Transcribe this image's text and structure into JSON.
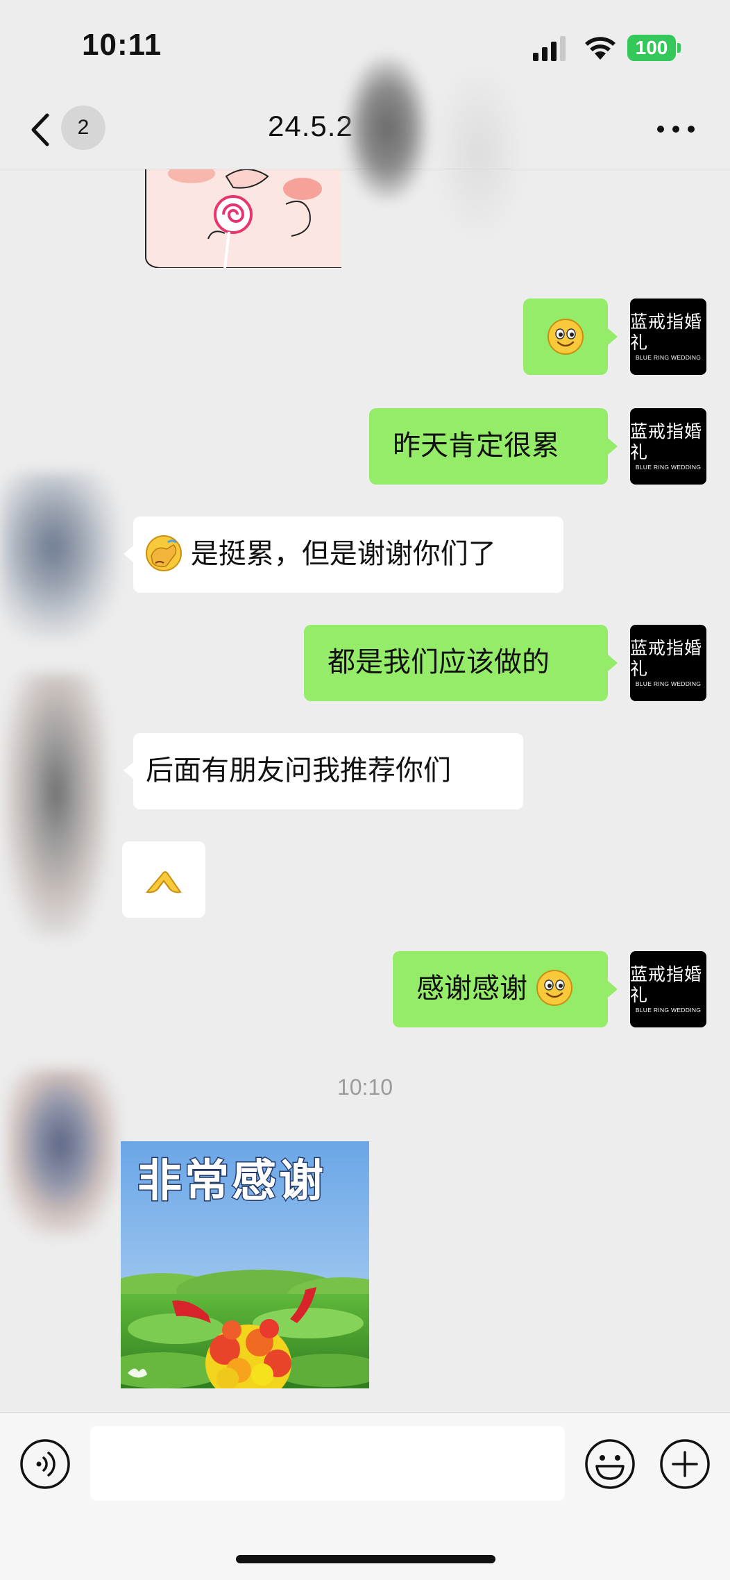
{
  "status_bar": {
    "time": "10:11",
    "battery": "100"
  },
  "nav": {
    "back_badge": "2",
    "title": "24.5.2"
  },
  "brand_avatar": {
    "cn": "蓝戒指婚礼",
    "en": "BLUE RING WEDDING"
  },
  "messages": [
    {
      "from": "me",
      "text": "",
      "emoji": "smile"
    },
    {
      "from": "me",
      "text": "昨天肯定很累"
    },
    {
      "from": "other",
      "text": "是挺累，但是谢谢你们了",
      "emoji_before": "facepalm"
    },
    {
      "from": "me",
      "text": "都是我们应该做的"
    },
    {
      "from": "other",
      "text": "后面有朋友问我推荐你们"
    },
    {
      "from": "other",
      "text": "",
      "emoji": "thanks-hands"
    },
    {
      "from": "me",
      "text": "感谢感谢",
      "emoji_after": "smile"
    }
  ],
  "timestamp": "10:10",
  "sticker": {
    "text": "非常感谢"
  },
  "colors": {
    "me_bubble": "#95ec69",
    "other_bubble": "#ffffff",
    "background": "#ededed",
    "battery": "#34c759"
  }
}
